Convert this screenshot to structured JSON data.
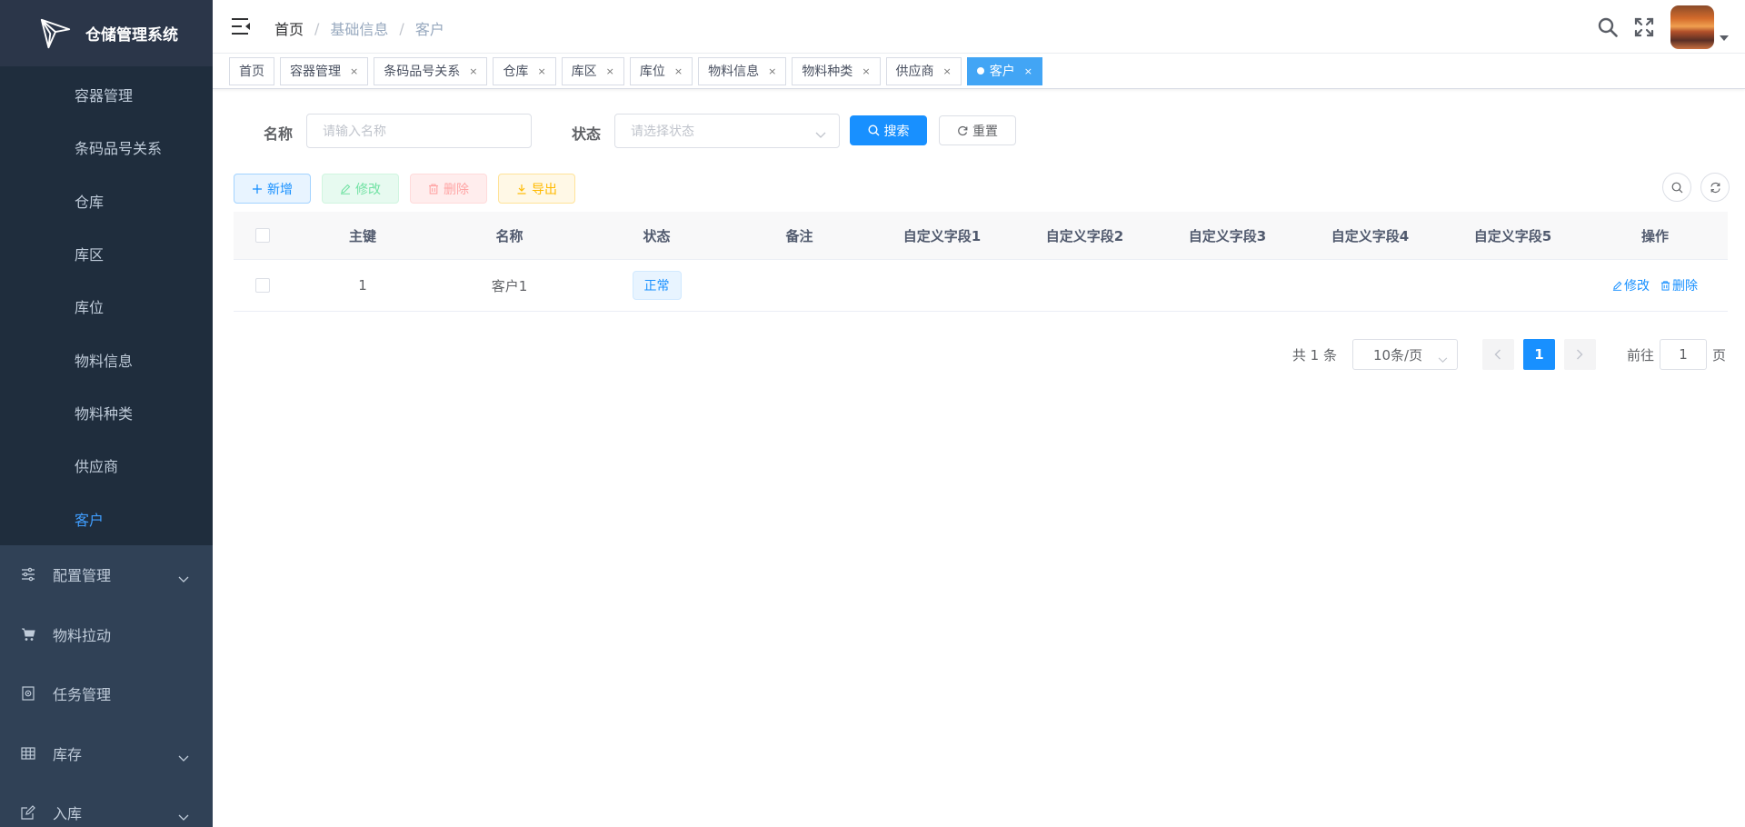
{
  "app": {
    "title": "仓储管理系统"
  },
  "sidebar": {
    "submenu": [
      {
        "label": "容器管理",
        "active": false
      },
      {
        "label": "条码品号关系",
        "active": false
      },
      {
        "label": "仓库",
        "active": false
      },
      {
        "label": "库区",
        "active": false
      },
      {
        "label": "库位",
        "active": false
      },
      {
        "label": "物料信息",
        "active": false
      },
      {
        "label": "物料种类",
        "active": false
      },
      {
        "label": "供应商",
        "active": false
      },
      {
        "label": "客户",
        "active": true
      }
    ],
    "menu": [
      {
        "label": "配置管理",
        "icon": "sliders-icon",
        "expandable": true
      },
      {
        "label": "物料拉动",
        "icon": "cart-icon",
        "expandable": false
      },
      {
        "label": "任务管理",
        "icon": "task-icon",
        "expandable": false
      },
      {
        "label": "库存",
        "icon": "grid-icon",
        "expandable": true
      },
      {
        "label": "入库",
        "icon": "edit-icon",
        "expandable": true
      }
    ]
  },
  "navbar": {
    "breadcrumb": [
      "首页",
      "基础信息",
      "客户"
    ],
    "separator": "/"
  },
  "tags": [
    {
      "label": "首页",
      "closable": false,
      "active": false
    },
    {
      "label": "容器管理",
      "closable": true,
      "active": false
    },
    {
      "label": "条码品号关系",
      "closable": true,
      "active": false
    },
    {
      "label": "仓库",
      "closable": true,
      "active": false
    },
    {
      "label": "库区",
      "closable": true,
      "active": false
    },
    {
      "label": "库位",
      "closable": true,
      "active": false
    },
    {
      "label": "物料信息",
      "closable": true,
      "active": false
    },
    {
      "label": "物料种类",
      "closable": true,
      "active": false
    },
    {
      "label": "供应商",
      "closable": true,
      "active": false
    },
    {
      "label": "客户",
      "closable": true,
      "active": true
    }
  ],
  "tag_close": "×",
  "search": {
    "name_label": "名称",
    "name_placeholder": "请输入名称",
    "status_label": "状态",
    "status_placeholder": "请选择状态",
    "search_button": "搜索",
    "reset_button": "重置"
  },
  "toolbar": {
    "add": "新增",
    "edit": "修改",
    "delete": "删除",
    "export": "导出"
  },
  "table": {
    "columns": [
      "主键",
      "名称",
      "状态",
      "备注",
      "自定义字段1",
      "自定义字段2",
      "自定义字段3",
      "自定义字段4",
      "自定义字段5",
      "操作"
    ],
    "rows": [
      {
        "id": "1",
        "name": "客户1",
        "status": "正常",
        "remark": "",
        "f1": "",
        "f2": "",
        "f3": "",
        "f4": "",
        "f5": "",
        "edit": "修改",
        "delete": "删除"
      }
    ]
  },
  "pagination": {
    "total": "共 1 条",
    "page_size": "10条/页",
    "current_page": "1",
    "goto_prefix": "前往",
    "goto_value": "1",
    "goto_suffix": "页"
  },
  "colors": {
    "sidebar_bg": "#304156",
    "submenu_bg": "#1f2d3d",
    "accent": "#1890ff",
    "active_tag": "#42a5f5"
  }
}
